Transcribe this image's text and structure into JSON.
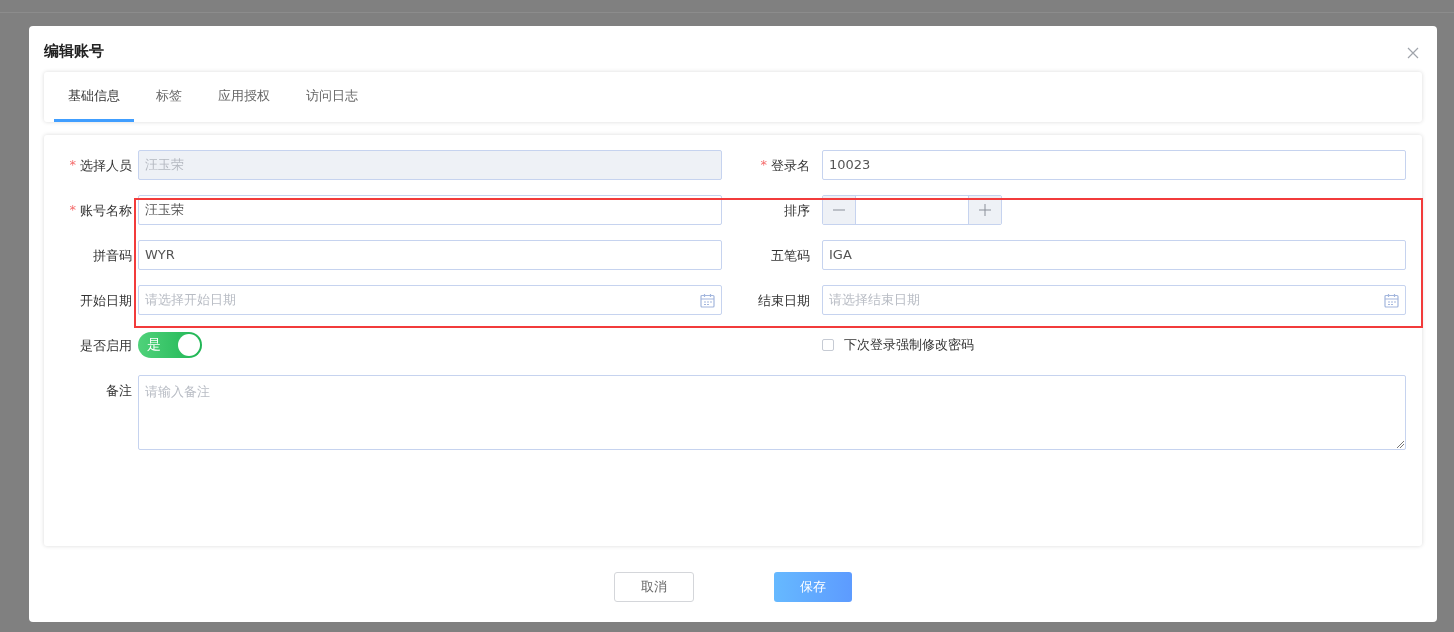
{
  "dialog": {
    "title": "编辑账号"
  },
  "tabs": [
    {
      "label": "基础信息",
      "selected": true
    },
    {
      "label": "标签",
      "selected": false
    },
    {
      "label": "应用授权",
      "selected": false
    },
    {
      "label": "访问日志",
      "selected": false
    }
  ],
  "fields": [
    {
      "kind": "text",
      "label": "选择人员",
      "mark": "*",
      "disabled": true,
      "value": "汪玉荣"
    },
    {
      "kind": "text",
      "label": "登录名",
      "mark": "*",
      "disabled": false,
      "value": "10023"
    },
    {
      "kind": "text",
      "label": "账号名称",
      "mark": "*",
      "disabled": false,
      "value": "汪玉荣"
    },
    {
      "kind": "number",
      "label": "排序"
    },
    {
      "kind": "text",
      "label": "拼音码",
      "disabled": false,
      "value": "WYR"
    },
    {
      "kind": "text",
      "label": "五笔码",
      "disabled": false,
      "value": "IGA"
    },
    {
      "kind": "date",
      "label": "开始日期",
      "placeholder": "请选择开始日期"
    },
    {
      "kind": "date",
      "label": "结束日期",
      "placeholder": "请选择结束日期"
    },
    {
      "kind": "switch",
      "label": "是否启用",
      "on": true,
      "text": "是"
    },
    {
      "kind": "checkbox",
      "text": "下次登录强制修改密码",
      "checked": false
    },
    {
      "kind": "textarea",
      "label": "备注",
      "placeholder": "请输入备注"
    }
  ],
  "buttons": [
    {
      "kind": "cancel",
      "label": "取消"
    },
    {
      "kind": "save",
      "label": "保存"
    }
  ]
}
